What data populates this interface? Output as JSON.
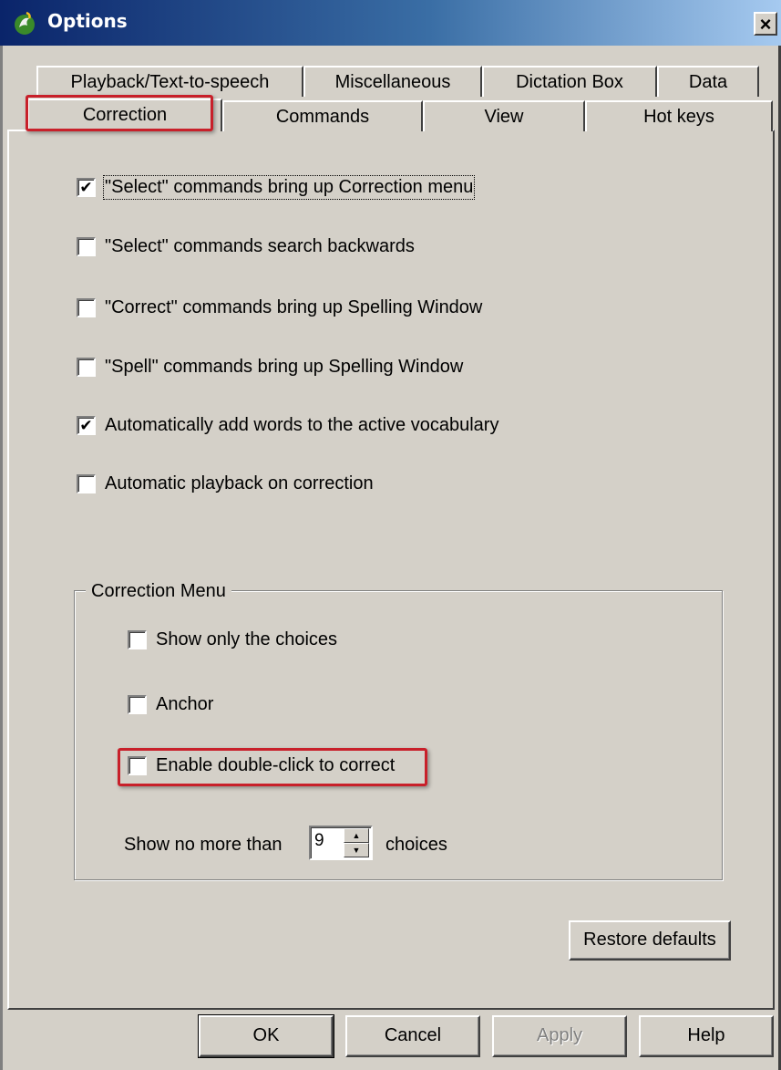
{
  "window": {
    "title": "Options",
    "close_glyph": "×",
    "icon": "dragon-app-icon"
  },
  "tabs_back": [
    {
      "label": "Playback/Text-to-speech"
    },
    {
      "label": "Miscellaneous"
    },
    {
      "label": "Dictation Box"
    },
    {
      "label": "Data"
    }
  ],
  "tabs_front": [
    {
      "label": "Correction",
      "active": true
    },
    {
      "label": "Commands"
    },
    {
      "label": "View"
    },
    {
      "label": "Hot keys"
    }
  ],
  "options": [
    {
      "label": "\"Select\" commands bring up Correction menu",
      "checked": true
    },
    {
      "label": "\"Select\" commands search backwards",
      "checked": false
    },
    {
      "label": "\"Correct\" commands bring up Spelling Window",
      "checked": false
    },
    {
      "label": "\"Spell\" commands bring up Spelling Window",
      "checked": false
    },
    {
      "label": "Automatically add words to the active vocabulary",
      "checked": true
    },
    {
      "label": "Automatic playback on correction",
      "checked": false
    }
  ],
  "correction_menu": {
    "title": "Correction Menu",
    "options": [
      {
        "label": "Show only the choices",
        "checked": false
      },
      {
        "label": "Anchor",
        "checked": false
      },
      {
        "label": "Enable double-click to correct",
        "checked": false
      }
    ],
    "show_no_more_than_label": "Show no more than",
    "choices_value": "9",
    "choices_suffix": "choices"
  },
  "buttons": {
    "restore_defaults": "Restore defaults",
    "ok": "OK",
    "cancel": "Cancel",
    "apply": "Apply",
    "help": "Help"
  },
  "colors": {
    "highlight": "#c8202a",
    "dialog_bg": "#d4d0c8",
    "titlebar_start": "#0a246a"
  }
}
